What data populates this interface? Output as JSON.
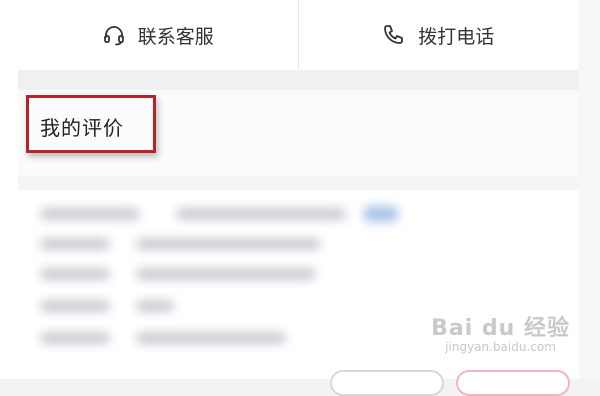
{
  "actions": {
    "contact_label": "联系客服",
    "call_label": "拨打电话"
  },
  "review": {
    "title": "我的评价"
  },
  "watermark": {
    "main": "Bai du 经验",
    "sub": "jingyan.baidu.com"
  },
  "colors": {
    "highlight": "#b5232d"
  }
}
